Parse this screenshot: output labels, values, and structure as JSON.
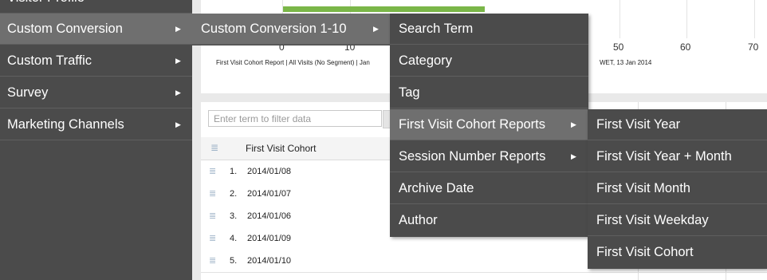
{
  "chart": {
    "ticks": [
      "0",
      "10",
      "50",
      "60",
      "70"
    ],
    "caption_left": "First Visit Cohort Report | All Visits (No Segment) | Jan",
    "caption_right": "WET, 13 Jan 2014"
  },
  "table": {
    "filter_placeholder": "Enter term to filter data",
    "column_header": "First Visit Cohort",
    "rows": [
      {
        "num": "1.",
        "value": "2014/01/08"
      },
      {
        "num": "2.",
        "value": "2014/01/07"
      },
      {
        "num": "3.",
        "value": "2014/01/06"
      },
      {
        "num": "4.",
        "value": "2014/01/09"
      },
      {
        "num": "5.",
        "value": "2014/01/10"
      }
    ]
  },
  "menu_main": {
    "partial_top": "Visitor Profile",
    "items": [
      "Custom Conversion",
      "Custom Traffic",
      "Survey",
      "Marketing Channels"
    ]
  },
  "menu_sub1": {
    "items": [
      "Custom Conversion 1-10"
    ]
  },
  "menu_sub2": {
    "items": [
      "Search Term",
      "Category",
      "Tag",
      "First Visit Cohort Reports",
      "Session Number Reports",
      "Archive Date",
      "Author"
    ]
  },
  "menu_sub3": {
    "items": [
      "First Visit Year",
      "First Visit Year + Month",
      "First Visit Month",
      "First Visit Weekday",
      "First Visit Cohort"
    ]
  },
  "icons": {
    "submenu_arrow": "triangle-right-icon",
    "row_icon": "breakdown-icon",
    "filter_go": "search-icon"
  },
  "colors": {
    "menu_bg": "#4b4b4b",
    "menu_active": "#6f6f6f",
    "chart_bar": "#7ab648"
  }
}
